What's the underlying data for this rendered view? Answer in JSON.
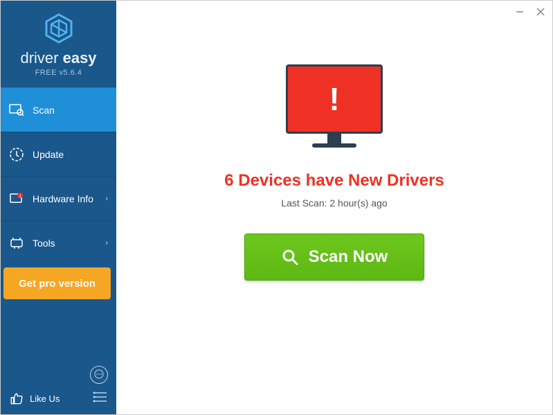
{
  "brand": {
    "name_light": "driver",
    "name_bold": "easy",
    "version": "FREE v5.6.4"
  },
  "sidebar": {
    "items": [
      {
        "label": "Scan",
        "icon": "scan-icon",
        "active": true,
        "chevron": false
      },
      {
        "label": "Update",
        "icon": "update-icon",
        "active": false,
        "chevron": false
      },
      {
        "label": "Hardware Info",
        "icon": "hardware-icon",
        "active": false,
        "chevron": true
      },
      {
        "label": "Tools",
        "icon": "tools-icon",
        "active": false,
        "chevron": true
      }
    ],
    "promo_label": "Get pro version",
    "like_label": "Like Us"
  },
  "main": {
    "headline": "6 Devices have New Drivers",
    "last_scan": "Last Scan: 2 hour(s) ago",
    "scan_btn_label": "Scan Now"
  },
  "colors": {
    "sidebar_bg": "#1a578b",
    "active_bg": "#1f90d8",
    "promo_bg": "#f5a623",
    "alert_red": "#ee3124",
    "scan_green": "#5db813"
  }
}
